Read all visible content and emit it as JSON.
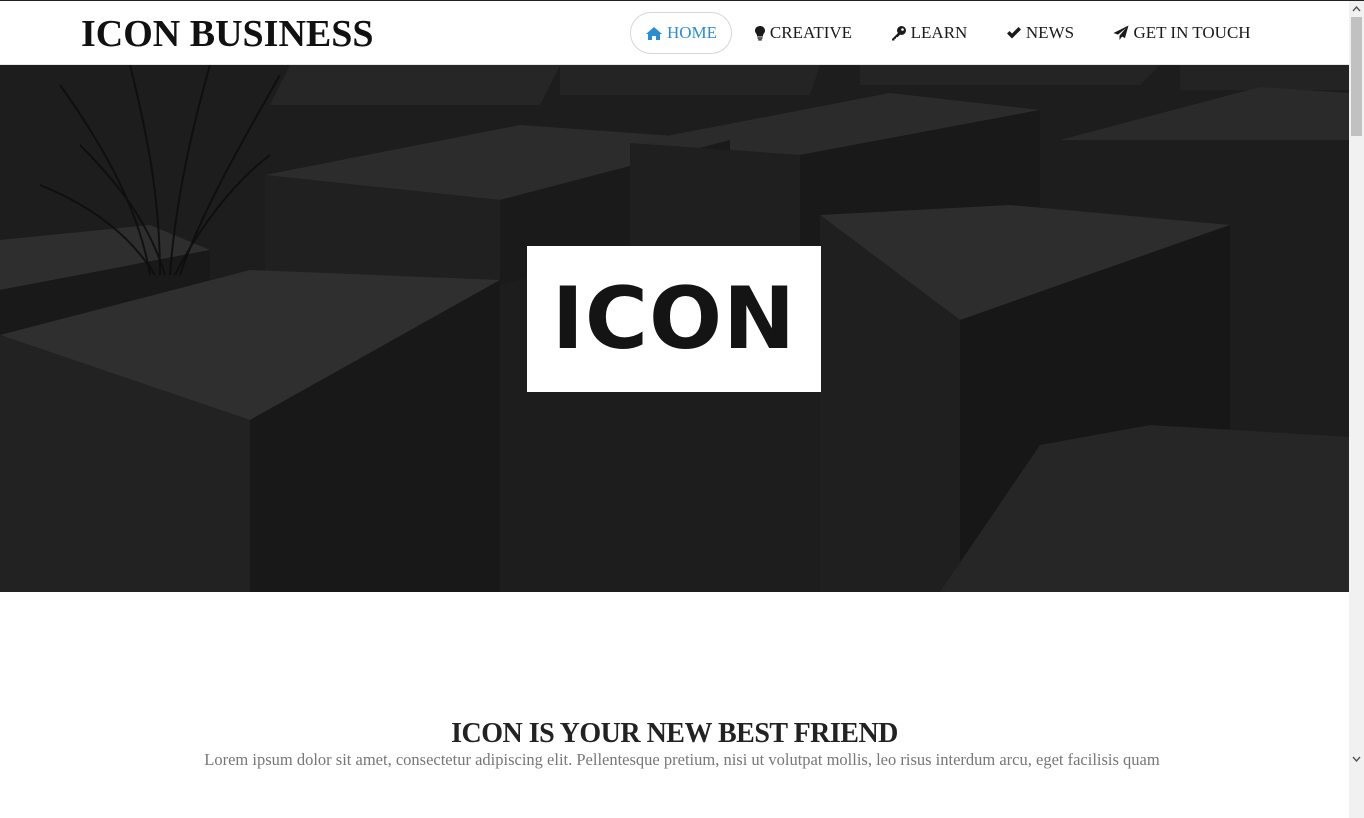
{
  "header": {
    "brand": "ICON BUSINESS",
    "nav": [
      {
        "label": "HOME",
        "icon": "home-icon",
        "active": true
      },
      {
        "label": "CREATIVE",
        "icon": "lightbulb-icon",
        "active": false
      },
      {
        "label": "LEARN",
        "icon": "key-icon",
        "active": false
      },
      {
        "label": "NEWS",
        "icon": "check-icon",
        "active": false
      },
      {
        "label": "GET IN TOUCH",
        "icon": "paper-plane-icon",
        "active": false
      }
    ]
  },
  "hero": {
    "logo_text": "ICON"
  },
  "intro": {
    "title": "ICON IS YOUR NEW BEST FRIEND",
    "text": "Lorem ipsum dolor sit amet, consectetur adipiscing elit. Pellentesque pretium, nisi ut volutpat mollis, leo risus interdum arcu, eget facilisis quam"
  },
  "colors": {
    "accent": "#2a8fd0",
    "hero_bg": "#1c1c1c",
    "text_dark": "#111111",
    "text_muted": "#777777"
  }
}
